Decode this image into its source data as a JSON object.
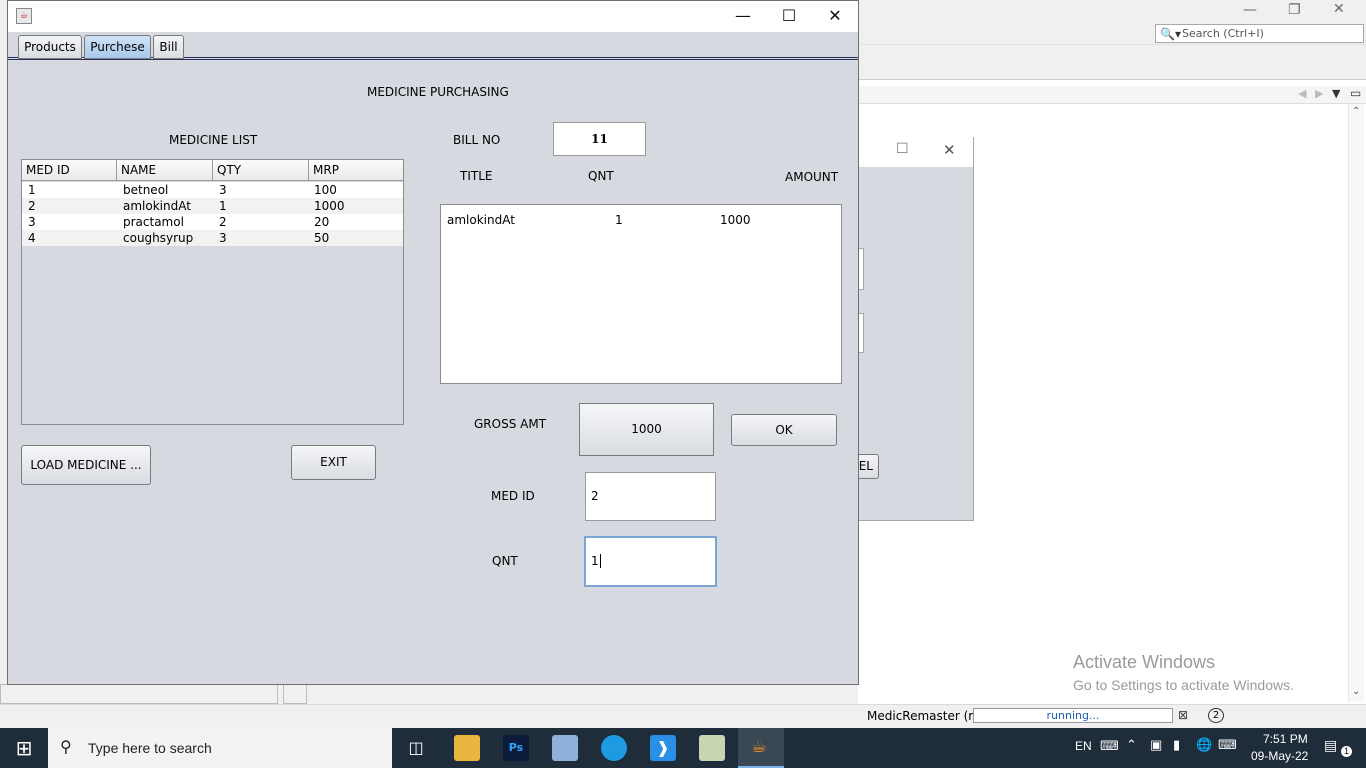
{
  "ide": {
    "search_placeholder": "Search (Ctrl+I)",
    "status_project": "MedicRemaster (run)",
    "status_progress": "running...",
    "notif_count": "2",
    "activate_title": "Activate Windows",
    "activate_sub": "Go to Settings to activate Windows."
  },
  "window": {
    "tabs": [
      "Products",
      "Purchese",
      "Bill"
    ],
    "selected_tab": "Purchese",
    "heading": "MEDICINE PURCHASING",
    "list_title": "MEDICINE LIST",
    "table": {
      "headers": [
        "MED ID",
        "NAME",
        "QTY",
        "MRP"
      ],
      "rows": [
        [
          "1",
          "betneol",
          "3",
          "100"
        ],
        [
          "2",
          "amlokindAt",
          "1",
          "1000"
        ],
        [
          "3",
          "practamol",
          "2",
          "20"
        ],
        [
          "4",
          "coughsyrup",
          "3",
          "50"
        ]
      ]
    },
    "bill_no_label": "BILL NO",
    "bill_no_value": "11",
    "col_title": "TITLE",
    "col_qnt": "QNT",
    "col_amount": "AMOUNT",
    "bill_line": {
      "title": "amlokindAt",
      "qnt": "1",
      "amount": "1000"
    },
    "gross_label": "GROSS AMT",
    "gross_value": "1000",
    "ok_label": "OK",
    "load_label": "LOAD MEDICINE ...",
    "exit_label": "EXIT",
    "medid_label": "MED ID",
    "medid_value": "2",
    "qnt_label": "QNT",
    "qnt_value": "1"
  },
  "background_dialog": {
    "button_fragment": "EL"
  },
  "taskbar": {
    "search_placeholder": "Type here to search",
    "lang": "EN",
    "time": "7:51 PM",
    "date": "09-May-22",
    "notifications": "1"
  },
  "colors": {
    "window_bg": "#d6d9df",
    "selected_tab": "#a9c9ec",
    "taskbar": "#1f2d3a"
  }
}
